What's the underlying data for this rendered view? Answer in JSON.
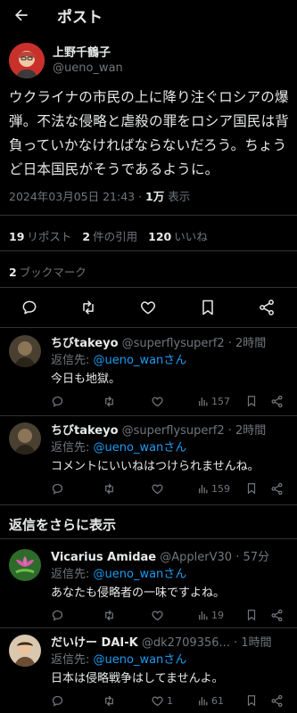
{
  "header": {
    "title": "ポスト"
  },
  "post": {
    "author_name": "上野千鶴子",
    "author_handle": "@ueno_wan",
    "text": "ウクライナの市民の上に降り注ぐロシアの爆弾。不法な侵略と虐殺の罪をロシア国民は背負っていかなければならないだろう。ちょうど日本国民がそうであるように。",
    "timestamp": "2024年03月05日 21:43",
    "separator": " · ",
    "views_count": "1万",
    "views_label": " 表示",
    "reposts_count": "19",
    "reposts_label": "リポスト",
    "quotes_count": "2",
    "quotes_label": "件の引用",
    "likes_count": "120",
    "likes_label": "いいね",
    "bookmarks_count": "2",
    "bookmarks_label": "ブックマーク"
  },
  "replies": [
    {
      "name": "ちびtakeyo",
      "handle": "@superflysuperf2",
      "time": " · 2時間",
      "reply_to_prefix": "返信先: ",
      "reply_to_handle": "@ueno_wanさん",
      "text": "今日も地獄。",
      "views": "157",
      "likes": ""
    },
    {
      "name": "ちびtakeyo",
      "handle": "@superflysuperf2",
      "time": " · 2時間",
      "reply_to_prefix": "返信先: ",
      "reply_to_handle": "@ueno_wanさん",
      "text": "コメントにいいねはつけられませんね。",
      "views": "159",
      "likes": ""
    }
  ],
  "show_more": "返信をさらに表示",
  "more_replies": [
    {
      "name": "Vicarius Amidae",
      "handle": "@ApplerV30",
      "time": " · 57分",
      "reply_to_prefix": "返信先: ",
      "reply_to_handle": "@ueno_wanさん",
      "text": "あなたも侵略者の一味ですよね。",
      "views": "19",
      "likes": ""
    },
    {
      "name": "だいけー DAI-K",
      "handle": "@dk2709356...",
      "time": " · 1時間",
      "reply_to_prefix": "返信先: ",
      "reply_to_handle": "@ueno_wanさん",
      "text": "日本は侵略戦争はしてませんよ。",
      "views": "61",
      "likes": "1"
    }
  ],
  "colors": {
    "background": "#000000",
    "text": "#e7e9ea",
    "muted": "#71767b",
    "link": "#1d9bf0",
    "divider": "#2f3336"
  }
}
